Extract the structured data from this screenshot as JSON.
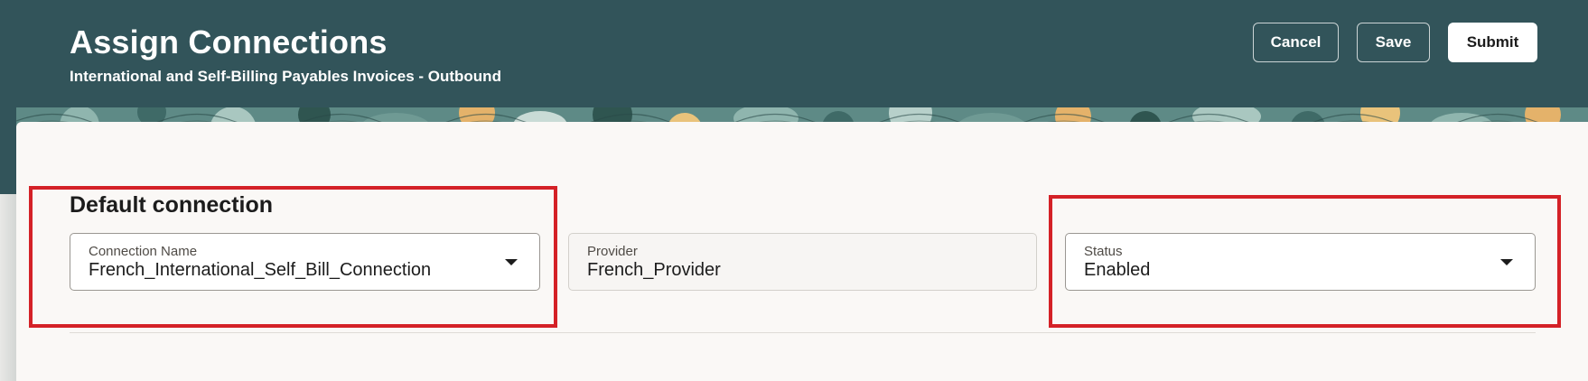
{
  "header": {
    "title": "Assign Connections",
    "subtitle": "International and Self-Billing Payables Invoices - Outbound",
    "buttons": {
      "cancel": "Cancel",
      "save": "Save",
      "submit": "Submit"
    }
  },
  "section": {
    "title": "Default connection",
    "fields": {
      "connection_name": {
        "label": "Connection Name",
        "value": "French_International_Self_Bill_Connection"
      },
      "provider": {
        "label": "Provider",
        "value": "French_Provider"
      },
      "status": {
        "label": "Status",
        "value": "Enabled"
      }
    }
  },
  "colors": {
    "header_bg": "#32545a",
    "card_bg": "#faf8f6",
    "highlight": "#d42127"
  },
  "icons": [
    "chevron-down-icon"
  ]
}
